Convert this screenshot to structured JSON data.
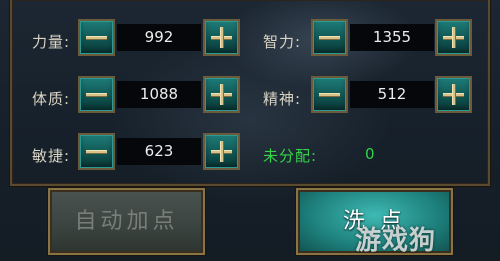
{
  "stats": {
    "strength": {
      "label": "力量:",
      "value": "992"
    },
    "intelligence": {
      "label": "智力:",
      "value": "1355"
    },
    "constitution": {
      "label": "体质:",
      "value": "1088"
    },
    "spirit": {
      "label": "精神:",
      "value": "512"
    },
    "agility": {
      "label": "敏捷:",
      "value": "623"
    }
  },
  "unallocated": {
    "label": "未分配:",
    "value": "0"
  },
  "buttons": {
    "auto_allocate": "自动加点",
    "reset": "洗 点"
  },
  "watermark": "游戏狗",
  "colors": {
    "free_points": "#33d44a",
    "button_teal": "#1e7c78",
    "frame_gold": "#8a7345"
  }
}
